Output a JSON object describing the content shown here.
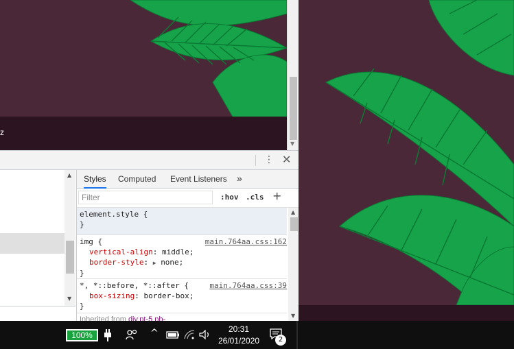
{
  "page": {
    "partial_text": "z"
  },
  "devtools": {
    "toolbar": {
      "menu_icon": "⋮",
      "close_icon": "✕"
    },
    "tabs": [
      {
        "label": "Styles",
        "active": true
      },
      {
        "label": "Computed",
        "active": false
      },
      {
        "label": "Event Listeners",
        "active": false
      },
      {
        "label": "»",
        "active": false
      }
    ],
    "filter": {
      "placeholder": "Filter"
    },
    "hov_label": ":hov",
    "cls_label": ".cls",
    "plus_label": "+",
    "rules": [
      {
        "selector": "element.style {",
        "close": "}"
      },
      {
        "selector": "img {",
        "source": "main.764aa.css:162",
        "declarations": [
          {
            "prop": "vertical-align",
            "value": "middle;"
          },
          {
            "prop": "border-style",
            "value": "none;"
          }
        ],
        "close": "}"
      },
      {
        "selector": "*, *::before, *::after {",
        "source": "main.764aa.css:39",
        "declarations": [
          {
            "prop": "box-sizing",
            "value": "border-box;"
          }
        ],
        "close": "}"
      }
    ],
    "inherited": {
      "prefix": "Inherited from",
      "selector": "div.pt-5.pb-"
    }
  },
  "taskbar": {
    "battery_percent": "100%",
    "time": "20:31",
    "date": "26/01/2020",
    "notification_count": "2"
  },
  "colors": {
    "accent": "#1a73e8",
    "leaf_green": "#16a34a",
    "page_bg": "#4a2838"
  }
}
